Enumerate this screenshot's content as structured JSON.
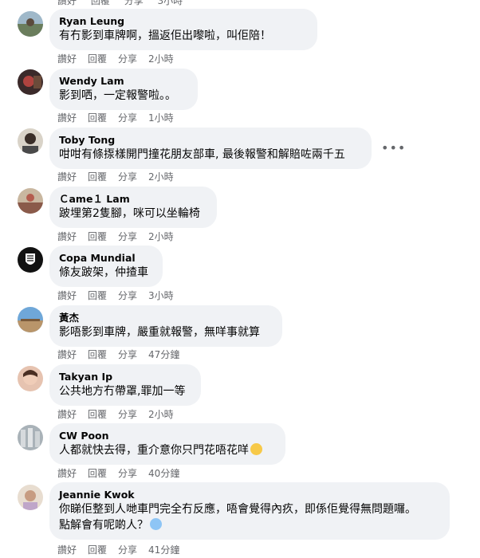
{
  "top_actions": [
    "讚好",
    "回覆",
    "分享",
    "3小時"
  ],
  "comments": [
    {
      "name": "Ryan Leung",
      "text": "有冇影到車牌啊，搵返佢出嚟啦￼，叫佢陪￼！",
      "like": "讚好",
      "reply": "回覆",
      "share": "分享",
      "time": "2小時"
    },
    {
      "name": "Wendy Lam",
      "text": "影到哂，一定報警啦。。",
      "like": "讚好",
      "reply": "回覆",
      "share": "分享",
      "time": "1小時"
    },
    {
      "name": "Toby Tong",
      "text": "咁咁有條揼樣開門撞花朋友部車, 最後報警和解賠咗兩千五",
      "like": "讚好",
      "reply": "回覆",
      "share": "分享",
      "time": "2小時",
      "more": "•••"
    },
    {
      "name": "Ｃame１ Lam",
      "text": "跛埋第2隻腳，咪可以坐輪椅",
      "like": "讚好",
      "reply": "回覆",
      "share": "分享",
      "time": "2小時"
    },
    {
      "name": "Copa Mundial",
      "text": "條友跛架，仲揸車",
      "like": "讚好",
      "reply": "回覆",
      "share": "分享",
      "time": "3小時"
    },
    {
      "name": "黃杰",
      "text": "影唔影到車牌，嚴重就報警，無咩事就算",
      "like": "讚好",
      "reply": "回覆",
      "share": "分享",
      "time": "47分鐘"
    },
    {
      "name": "Takyan Ip",
      "text": "公共地方冇帶罩,罪加一等",
      "like": "讚好",
      "reply": "回覆",
      "share": "分享",
      "time": "2小時"
    },
    {
      "name": "CW Poon",
      "text": "人都就快去得，重介意你只門花唔花咩",
      "emoji": "laughing-emoji",
      "like": "讚好",
      "reply": "回覆",
      "share": "分享",
      "time": "40分鐘"
    },
    {
      "name": "Jeannie Kwok",
      "text": "你睇佢整到人哋車門完全冇反應，唔會覺得內疚，即係佢覺得無問題囉。",
      "text2": "點解會有呢啲人？",
      "emoji": "scared-emoji",
      "like": "讚好",
      "reply": "回覆",
      "share": "分享",
      "time": "41分鐘"
    }
  ],
  "colors": {
    "bubble": "#f0f2f5",
    "meta": "#65676b",
    "text": "#050505"
  }
}
